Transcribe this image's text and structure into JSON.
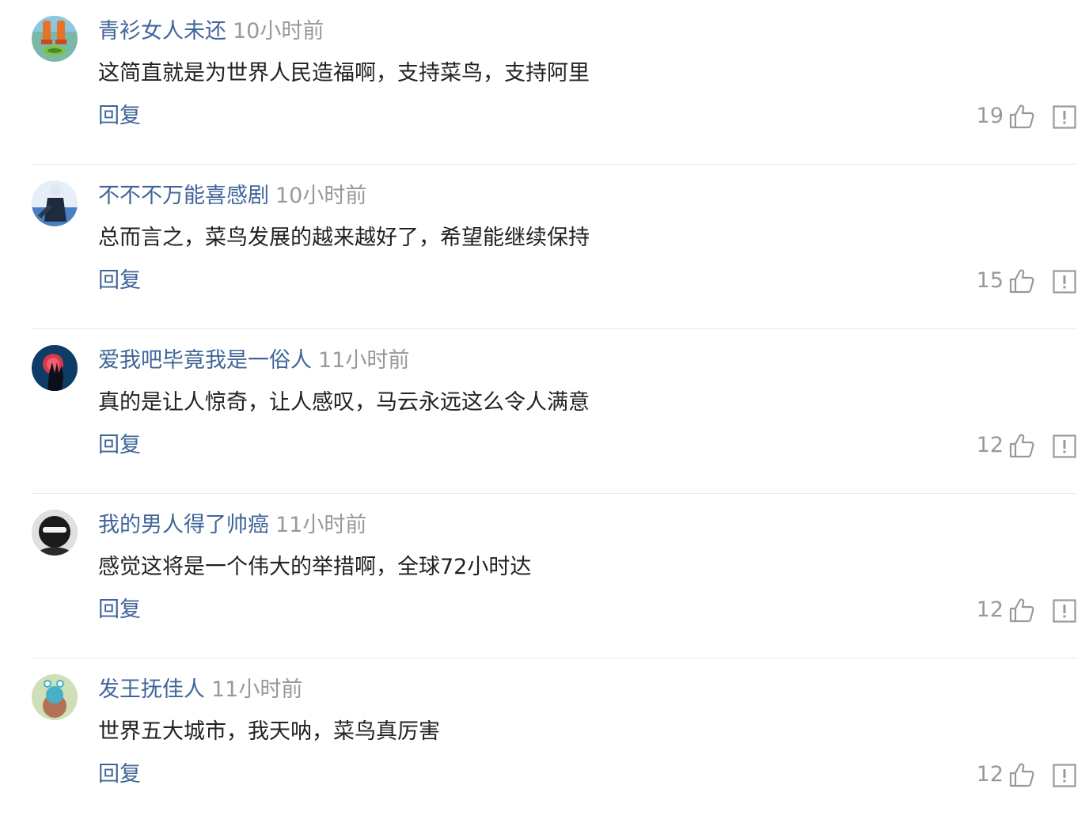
{
  "comments": [
    {
      "username": "青衫女人未还",
      "time": "10小时前",
      "content": "这简直就是为世界人民造福啊，支持菜鸟，支持阿里",
      "reply_label": "回复",
      "likes": "19",
      "avatar_icon": "cartoon-avatar-icon"
    },
    {
      "username": "不不不万能喜感剧",
      "time": "10小时前",
      "content": "总而言之，菜鸟发展的越来越好了，希望能继续保持",
      "reply_label": "回复",
      "likes": "15",
      "avatar_icon": "blue-figure-avatar-icon"
    },
    {
      "username": "爱我吧毕竟我是一俗人",
      "time": "11小时前",
      "content": "真的是让人惊奇，让人感叹，马云永远这么令人满意",
      "reply_label": "回复",
      "likes": "12",
      "avatar_icon": "red-hand-avatar-icon"
    },
    {
      "username": "我的男人得了帅癌",
      "time": "11小时前",
      "content": "感觉这将是一个伟大的举措啊，全球72小时达",
      "reply_label": "回复",
      "likes": "12",
      "avatar_icon": "masked-person-avatar-icon"
    },
    {
      "username": "发王抚佳人",
      "time": "11小时前",
      "content": "世界五大城市，我天呐，菜鸟真厉害",
      "reply_label": "回复",
      "likes": "12",
      "avatar_icon": "cartoon-character-avatar-icon"
    }
  ],
  "colors": {
    "username": "#406599",
    "reply": "#406599",
    "meta": "#999999",
    "content": "#222222",
    "divider": "#e9e9e9"
  }
}
